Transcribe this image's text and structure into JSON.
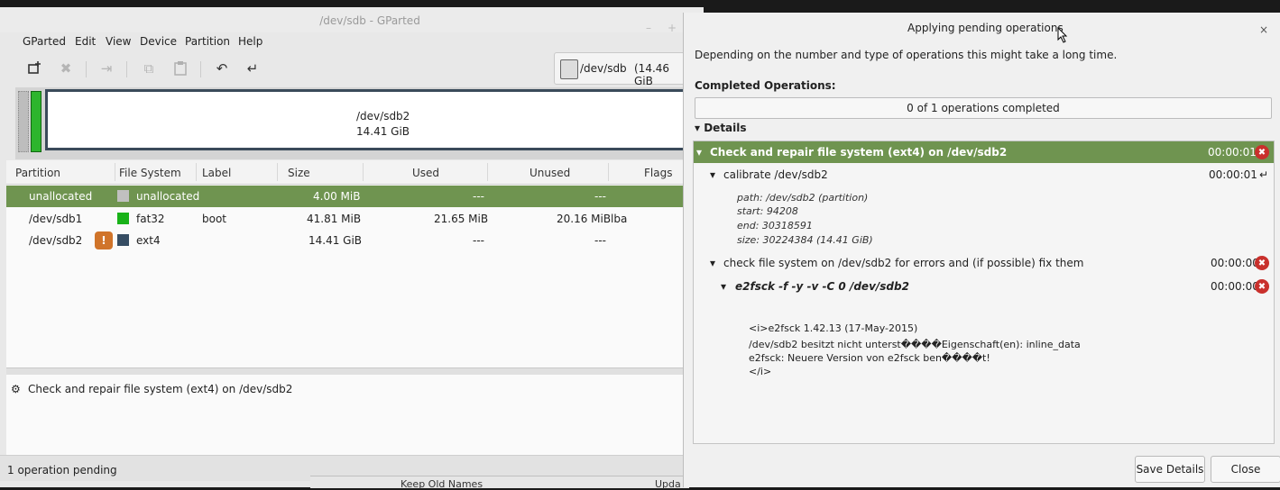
{
  "main_window": {
    "title": "/dev/sdb - GParted",
    "window_buttons": [
      "–",
      "+"
    ],
    "menu": [
      "GParted",
      "Edit",
      "View",
      "Device",
      "Partition",
      "Help"
    ],
    "device_selector": {
      "device": "/dev/sdb",
      "size": "(14.46 GiB"
    },
    "disk_map": {
      "partition": "/dev/sdb2",
      "size": "14.41 GiB"
    },
    "table": {
      "headers": [
        "Partition",
        "File System",
        "Label",
        "Size",
        "Used",
        "Unused",
        "Flags"
      ],
      "rows": [
        {
          "partition": "unallocated",
          "filesystem": "unallocated",
          "label": "",
          "size": "4.00 MiB",
          "used": "---",
          "unused": "---",
          "flags": "",
          "swatch": "#c0c0c0"
        },
        {
          "partition": "/dev/sdb1",
          "filesystem": "fat32",
          "label": "boot",
          "size": "41.81 MiB",
          "used": "21.65 MiB",
          "unused": "20.16 MiB",
          "flags": "lba",
          "swatch": "#19b219"
        },
        {
          "partition": "/dev/sdb2",
          "filesystem": "ext4",
          "label": "",
          "size": "14.41 GiB",
          "used": "---",
          "unused": "---",
          "flags": "",
          "swatch": "#364d63",
          "warning": "!"
        }
      ]
    },
    "pending_operation": "Check and repair file system (ext4) on /dev/sdb2",
    "status": "1 operation pending",
    "background_strip": {
      "left": "Keep Old Names",
      "right": "Upda"
    }
  },
  "dialog": {
    "title": "Applying pending operations",
    "close_glyph": "×",
    "description": "Depending on the number and type of operations this might take a long time.",
    "completed_label": "Completed Operations:",
    "progress_text": "0 of 1 operations completed",
    "progress_fraction": 0,
    "details_label": "Details",
    "operation": {
      "title": "Check and repair file system (ext4) on /dev/sdb2",
      "time": "00:00:01"
    },
    "calibrate": {
      "title": "calibrate /dev/sdb2",
      "time": "00:00:01",
      "lines": [
        "path: /dev/sdb2 (partition)",
        "start: 94208",
        "end: 30318591",
        "size: 30224384 (14.41 GiB)"
      ]
    },
    "check": {
      "title": "check file system on /dev/sdb2 for errors and (if possible) fix them",
      "time": "00:00:00"
    },
    "command": {
      "title": "e2fsck -f -y -v -C 0 /dev/sdb2",
      "time": "00:00:00"
    },
    "output": [
      "<i>e2fsck 1.42.13 (17-May-2015)",
      "/dev/sdb2 besitzt nicht unterst����Eigenschaft(en): inline_data",
      "e2fsck: Neuere Version von e2fsck ben����t!",
      "</i>"
    ],
    "buttons": {
      "save": "Save Details",
      "close": "Close"
    },
    "colors": {
      "accent_green": "#6f9450",
      "error_red": "#c9302c"
    }
  }
}
